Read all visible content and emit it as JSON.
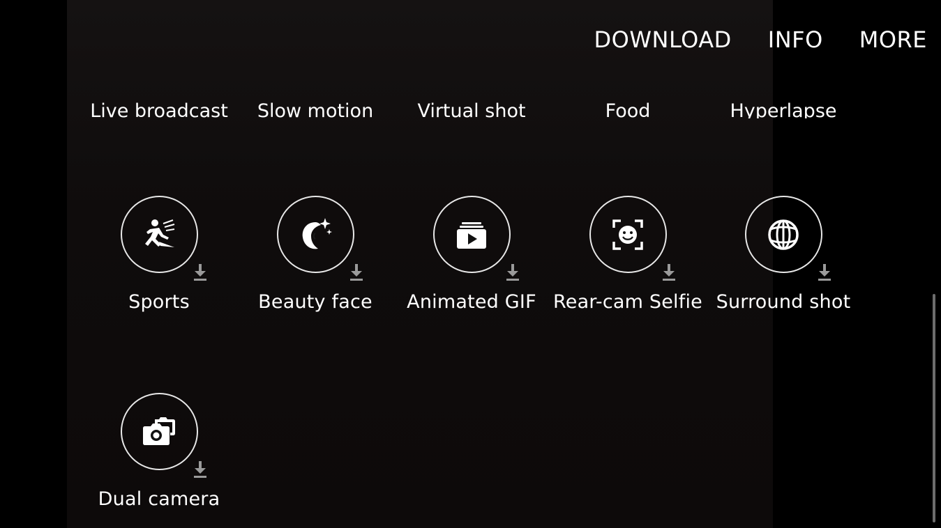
{
  "topbar": {
    "download": "DOWNLOAD",
    "info": "INFO",
    "more": "MORE"
  },
  "row_cut": [
    "Live broadcast",
    "Slow motion",
    "Virtual shot",
    "Food",
    "Hyperlapse"
  ],
  "modes": [
    {
      "label": "Sports",
      "icon": "sports-runner-icon"
    },
    {
      "label": "Beauty face",
      "icon": "beauty-face-icon"
    },
    {
      "label": "Animated GIF",
      "icon": "animated-gif-icon"
    },
    {
      "label": "Rear-cam Selfie",
      "icon": "rear-cam-selfie-icon"
    },
    {
      "label": "Surround shot",
      "icon": "surround-globe-icon"
    },
    {
      "label": "Dual camera",
      "icon": "dual-camera-icon"
    }
  ],
  "colors": {
    "background": "#000000",
    "text": "#ffffff",
    "download_arrow": "#9a9a9a"
  }
}
